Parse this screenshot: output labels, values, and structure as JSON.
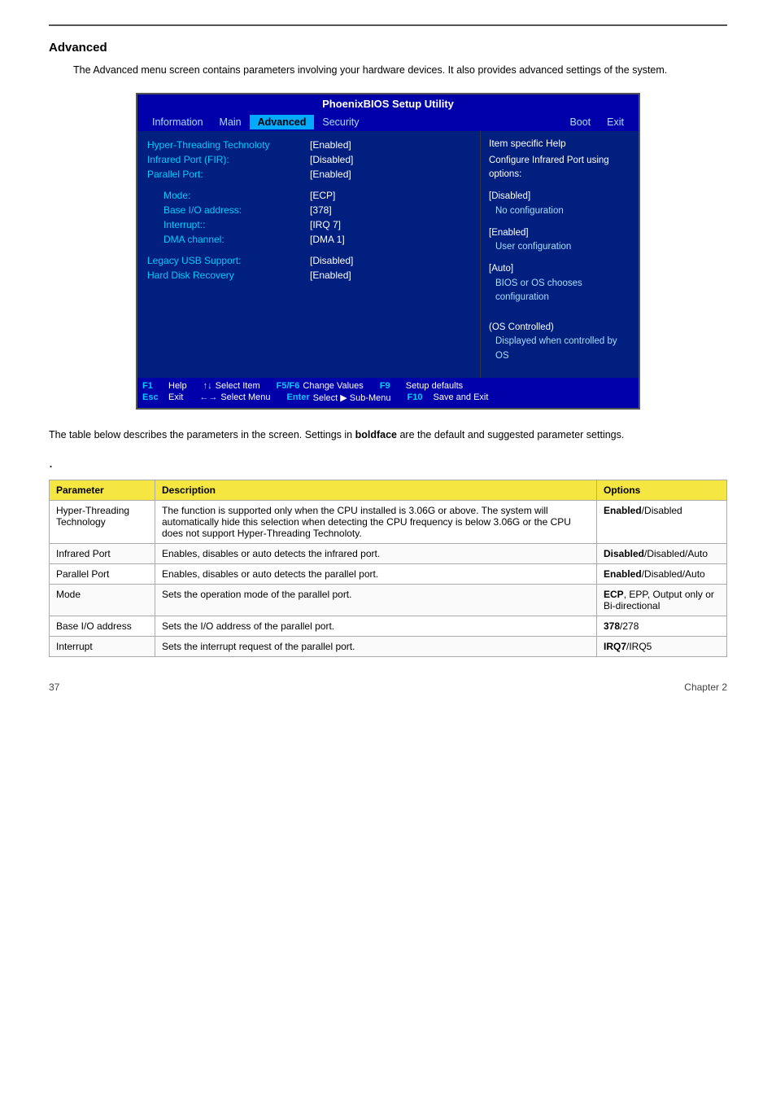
{
  "page": {
    "top_rule": true,
    "section_title": "Advanced",
    "intro_text": "The Advanced menu screen contains parameters involving your hardware devices. It also provides advanced settings of the system.",
    "desc_text": "The table below describes the parameters in the screen. Settings in <b>boldface</b> are the default and suggested parameter settings.",
    "dot": ".",
    "page_number": "37",
    "chapter": "Chapter 2"
  },
  "bios": {
    "title": "PhoenixBIOS Setup Utility",
    "nav_items": [
      {
        "label": "Information",
        "active": false
      },
      {
        "label": "Main",
        "active": false
      },
      {
        "label": "Advanced",
        "active": true
      },
      {
        "label": "Security",
        "active": false
      },
      {
        "label": "Boot",
        "active": false
      },
      {
        "label": "Exit",
        "active": false
      }
    ],
    "help_title": "Item specific Help",
    "rows": [
      {
        "label": "Hyper-Threading Technoloty",
        "value": "[Enabled]"
      },
      {
        "label": "Infrared Port (FIR):",
        "value": "[Disabled]"
      },
      {
        "label": "Parallel Port:",
        "value": "[Enabled]"
      },
      {
        "label": "",
        "value": ""
      },
      {
        "label": "Mode:",
        "value": "[ECP]"
      },
      {
        "label": "Base I/O address:",
        "value": "[378]"
      },
      {
        "label": "Interrupt::",
        "value": "[IRQ 7]"
      },
      {
        "label": "DMA channel:",
        "value": "[DMA 1]"
      },
      {
        "label": "",
        "value": ""
      },
      {
        "label": "Legacy USB Support:",
        "value": "[Disabled]"
      },
      {
        "label": "Hard Disk Recovery",
        "value": "[Enabled]"
      }
    ],
    "help_blocks": [
      {
        "value": "Configure Infrared Port using options:"
      },
      {
        "value": "[Disabled]",
        "text": "No configuration"
      },
      {
        "value": "[Enabled]",
        "text": "User configuration"
      },
      {
        "value": "[Auto]",
        "text": "BIOS or OS chooses configuration"
      },
      {
        "value": "(OS Controlled)",
        "text": "Displayed when controlled by OS"
      }
    ],
    "footer_rows": [
      [
        {
          "key": "F1",
          "desc": "Help"
        },
        {
          "arrow": "↑↓",
          "desc": "Select Item"
        },
        {
          "key": "F5/F6",
          "desc": "Change Values"
        },
        {
          "key": "F9",
          "desc": "Setup defaults"
        }
      ],
      [
        {
          "key": "Esc",
          "desc": "Exit"
        },
        {
          "arrow": "←→",
          "desc": "Select Menu"
        },
        {
          "key": "Enter",
          "desc": "Select ▶ Sub-Menu"
        },
        {
          "key": "F10",
          "desc": "Save and Exit"
        }
      ]
    ]
  },
  "table": {
    "headers": [
      "Parameter",
      "Description",
      "Options"
    ],
    "rows": [
      {
        "param": "Hyper-Threading Technology",
        "desc": "The function is supported only when the CPU installed is 3.06G or above. The system will automatically hide this selection when detecting the CPU frequency is below 3.06G or the CPU does not support Hyper-Threading Technoloty.",
        "options_bold": "Enabled",
        "options_rest": "/Disabled"
      },
      {
        "param": "Infrared Port",
        "desc": "Enables, disables or auto detects the infrared port.",
        "options_bold": "Disabled",
        "options_rest": "/Disabled/Auto"
      },
      {
        "param": "Parallel Port",
        "desc": "Enables, disables or auto detects the parallel port.",
        "options_bold": "Enabled",
        "options_rest": "/Disabled/Auto"
      },
      {
        "param": "Mode",
        "desc": "Sets the operation mode of the parallel port.",
        "options_bold": "ECP",
        "options_rest": ", EPP, Output only or Bi-directional"
      },
      {
        "param": "Base I/O address",
        "desc": "Sets the I/O address of the parallel port.",
        "options_bold": "378",
        "options_rest": "/278"
      },
      {
        "param": "Interrupt",
        "desc": "Sets the interrupt request of the parallel port.",
        "options_bold": "IRQ7",
        "options_rest": "/IRQ5"
      }
    ]
  }
}
